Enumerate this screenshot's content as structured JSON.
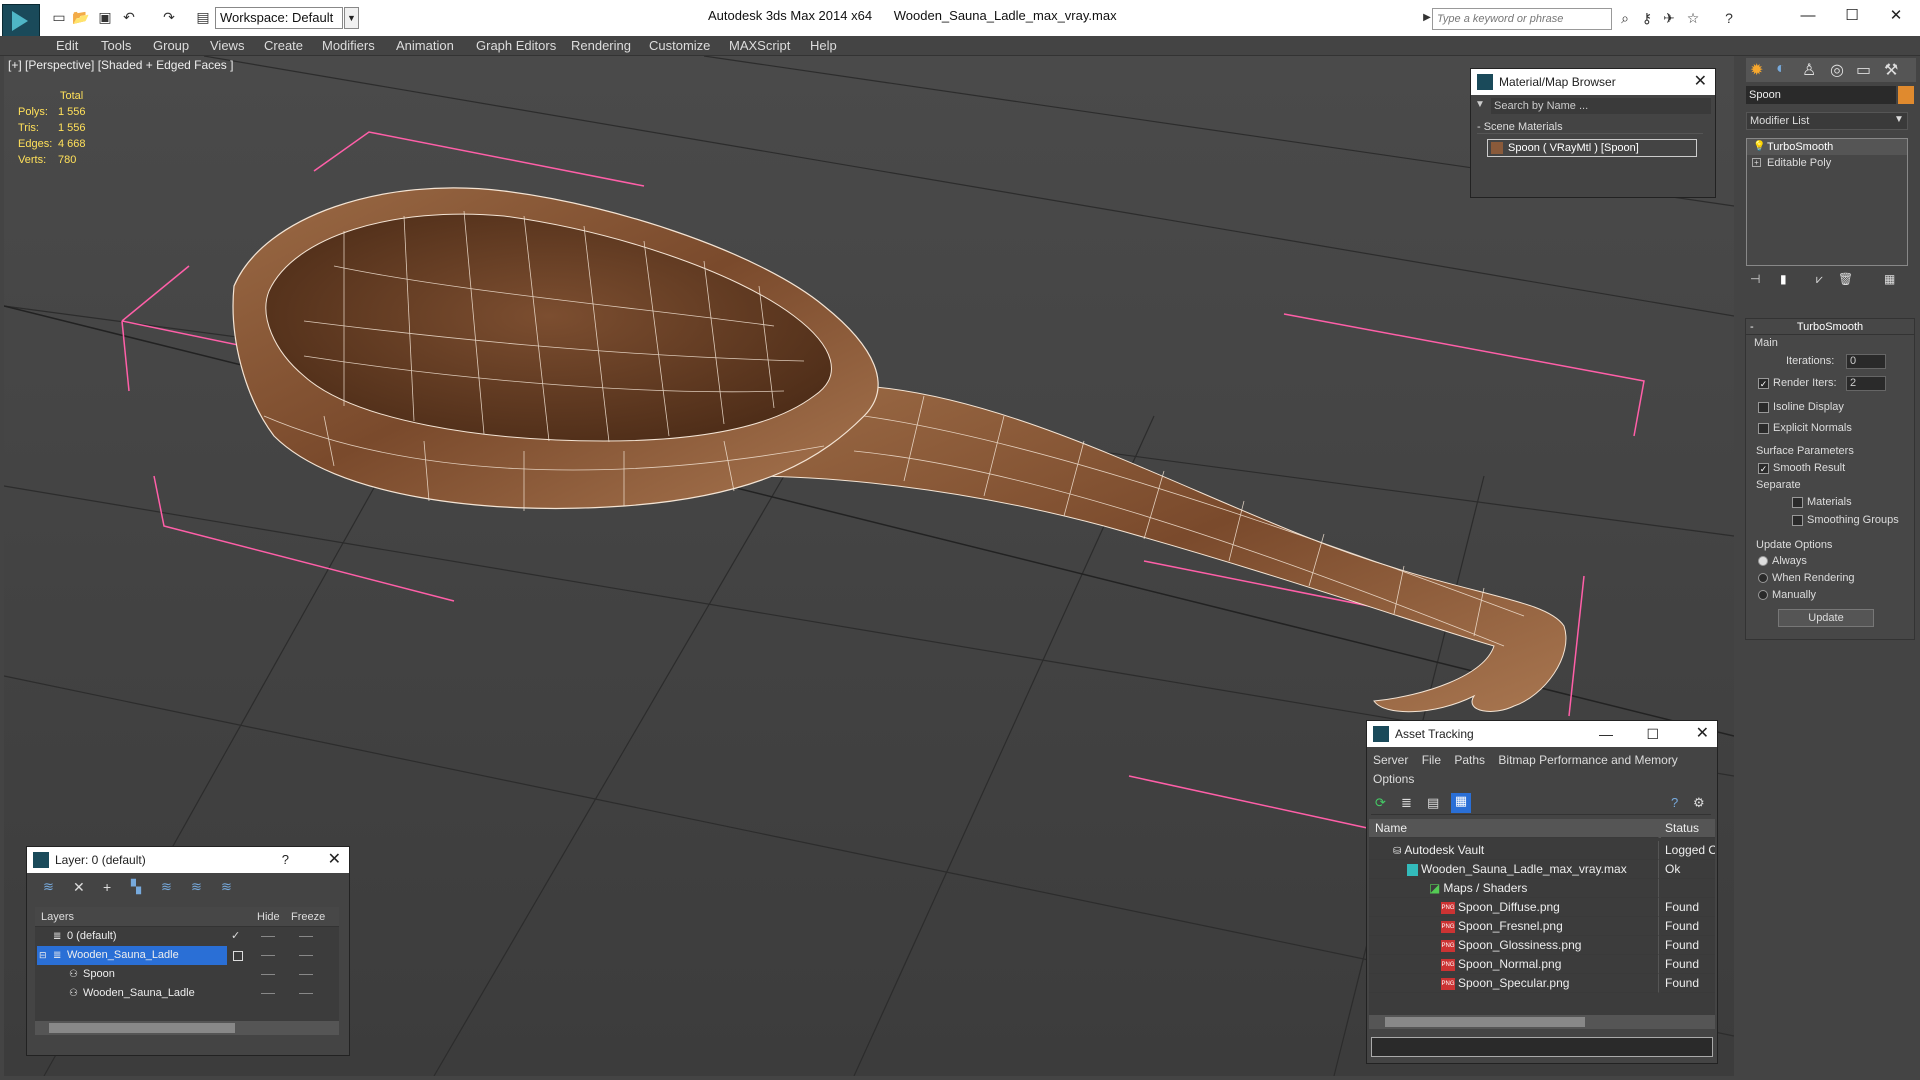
{
  "app": {
    "title": "Autodesk 3ds Max  2014 x64",
    "file": "Wooden_Sauna_Ladle_max_vray.max",
    "workspace": "Workspace: Default"
  },
  "search": {
    "placeholder": "Type a keyword or phrase"
  },
  "menu": [
    "Edit",
    "Tools",
    "Group",
    "Views",
    "Create",
    "Modifiers",
    "Animation",
    "Graph Editors",
    "Rendering",
    "Customize",
    "MAXScript",
    "Help"
  ],
  "viewport": {
    "label": "[+] [Perspective] [Shaded + Edged Faces ]",
    "stats_header": "Total",
    "stats": [
      {
        "k": "Polys:",
        "v": "1 556"
      },
      {
        "k": "Tris:",
        "v": "1 556"
      },
      {
        "k": "Edges:",
        "v": "4 668"
      },
      {
        "k": "Verts:",
        "v": "780"
      }
    ]
  },
  "material_browser": {
    "title": "Material/Map Browser",
    "search": "Search by Name ...",
    "section": "- Scene Materials",
    "item": "Spoon ( VRayMtl ) [Spoon]"
  },
  "command_panel": {
    "object_name": "Spoon",
    "modifier_list": "Modifier List",
    "stack": [
      "TurboSmooth",
      "Editable Poly"
    ],
    "rollout_title": "TurboSmooth",
    "main": "Main",
    "iterations_label": "Iterations:",
    "iterations": "0",
    "render_iters_label": "Render Iters:",
    "render_iters": "2",
    "isoline": "Isoline Display",
    "explicit": "Explicit Normals",
    "surface": "Surface Parameters",
    "smooth_result": "Smooth Result",
    "separate": "Separate",
    "materials": "Materials",
    "smoothing_groups": "Smoothing Groups",
    "update_options": "Update Options",
    "always": "Always",
    "when_rendering": "When Rendering",
    "manually": "Manually",
    "update": "Update"
  },
  "asset_tracking": {
    "title": "Asset Tracking",
    "menus": [
      "Server",
      "File",
      "Paths",
      "Bitmap Performance and Memory"
    ],
    "options": "Options",
    "col_name": "Name",
    "col_status": "Status",
    "rows": [
      {
        "name": "Autodesk Vault",
        "status": "Logged O"
      },
      {
        "name": "Wooden_Sauna_Ladle_max_vray.max",
        "status": "Ok"
      },
      {
        "name": "Maps / Shaders",
        "status": ""
      },
      {
        "name": "Spoon_Diffuse.png",
        "status": "Found"
      },
      {
        "name": "Spoon_Fresnel.png",
        "status": "Found"
      },
      {
        "name": "Spoon_Glossiness.png",
        "status": "Found"
      },
      {
        "name": "Spoon_Normal.png",
        "status": "Found"
      },
      {
        "name": "Spoon_Specular.png",
        "status": "Found"
      }
    ]
  },
  "layers": {
    "title": "Layer: 0 (default)",
    "help": "?",
    "col_layers": "Layers",
    "col_hide": "Hide",
    "col_freeze": "Freeze",
    "rows": [
      {
        "name": "0 (default)"
      },
      {
        "name": "Wooden_Sauna_Ladle"
      },
      {
        "name": "Spoon"
      },
      {
        "name": "Wooden_Sauna_Ladle"
      }
    ]
  },
  "colors": {
    "accent": "#2a6fd6",
    "viewport": "#474747",
    "wood": "#8a5a3a",
    "bracket": "#ff5fa8"
  }
}
